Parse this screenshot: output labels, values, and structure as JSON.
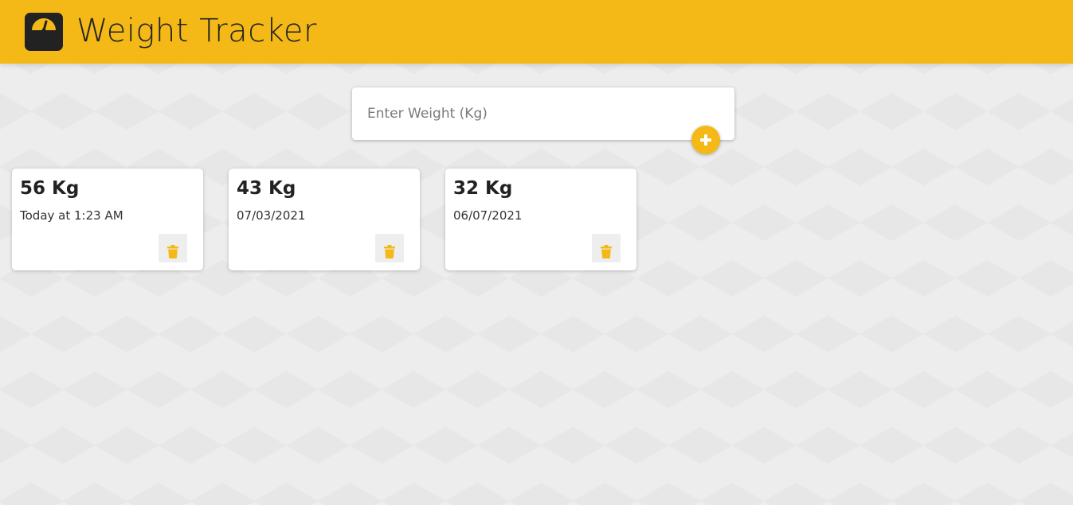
{
  "header": {
    "title": "Weight Tracker",
    "logo_icon": "scale-icon",
    "background_color": "#f4b916"
  },
  "entry_form": {
    "placeholder": "Enter Weight (Kg)",
    "value": "",
    "add_icon": "plus-icon"
  },
  "entries": [
    {
      "weight": "56 Kg",
      "date": "Today at 1:23 AM",
      "delete_icon": "trash-icon"
    },
    {
      "weight": "43 Kg",
      "date": "07/03/2021",
      "delete_icon": "trash-icon"
    },
    {
      "weight": "32 Kg",
      "date": "06/07/2021",
      "delete_icon": "trash-icon"
    }
  ],
  "colors": {
    "accent": "#f4b916",
    "text": "#222222",
    "background": "#ededed"
  }
}
